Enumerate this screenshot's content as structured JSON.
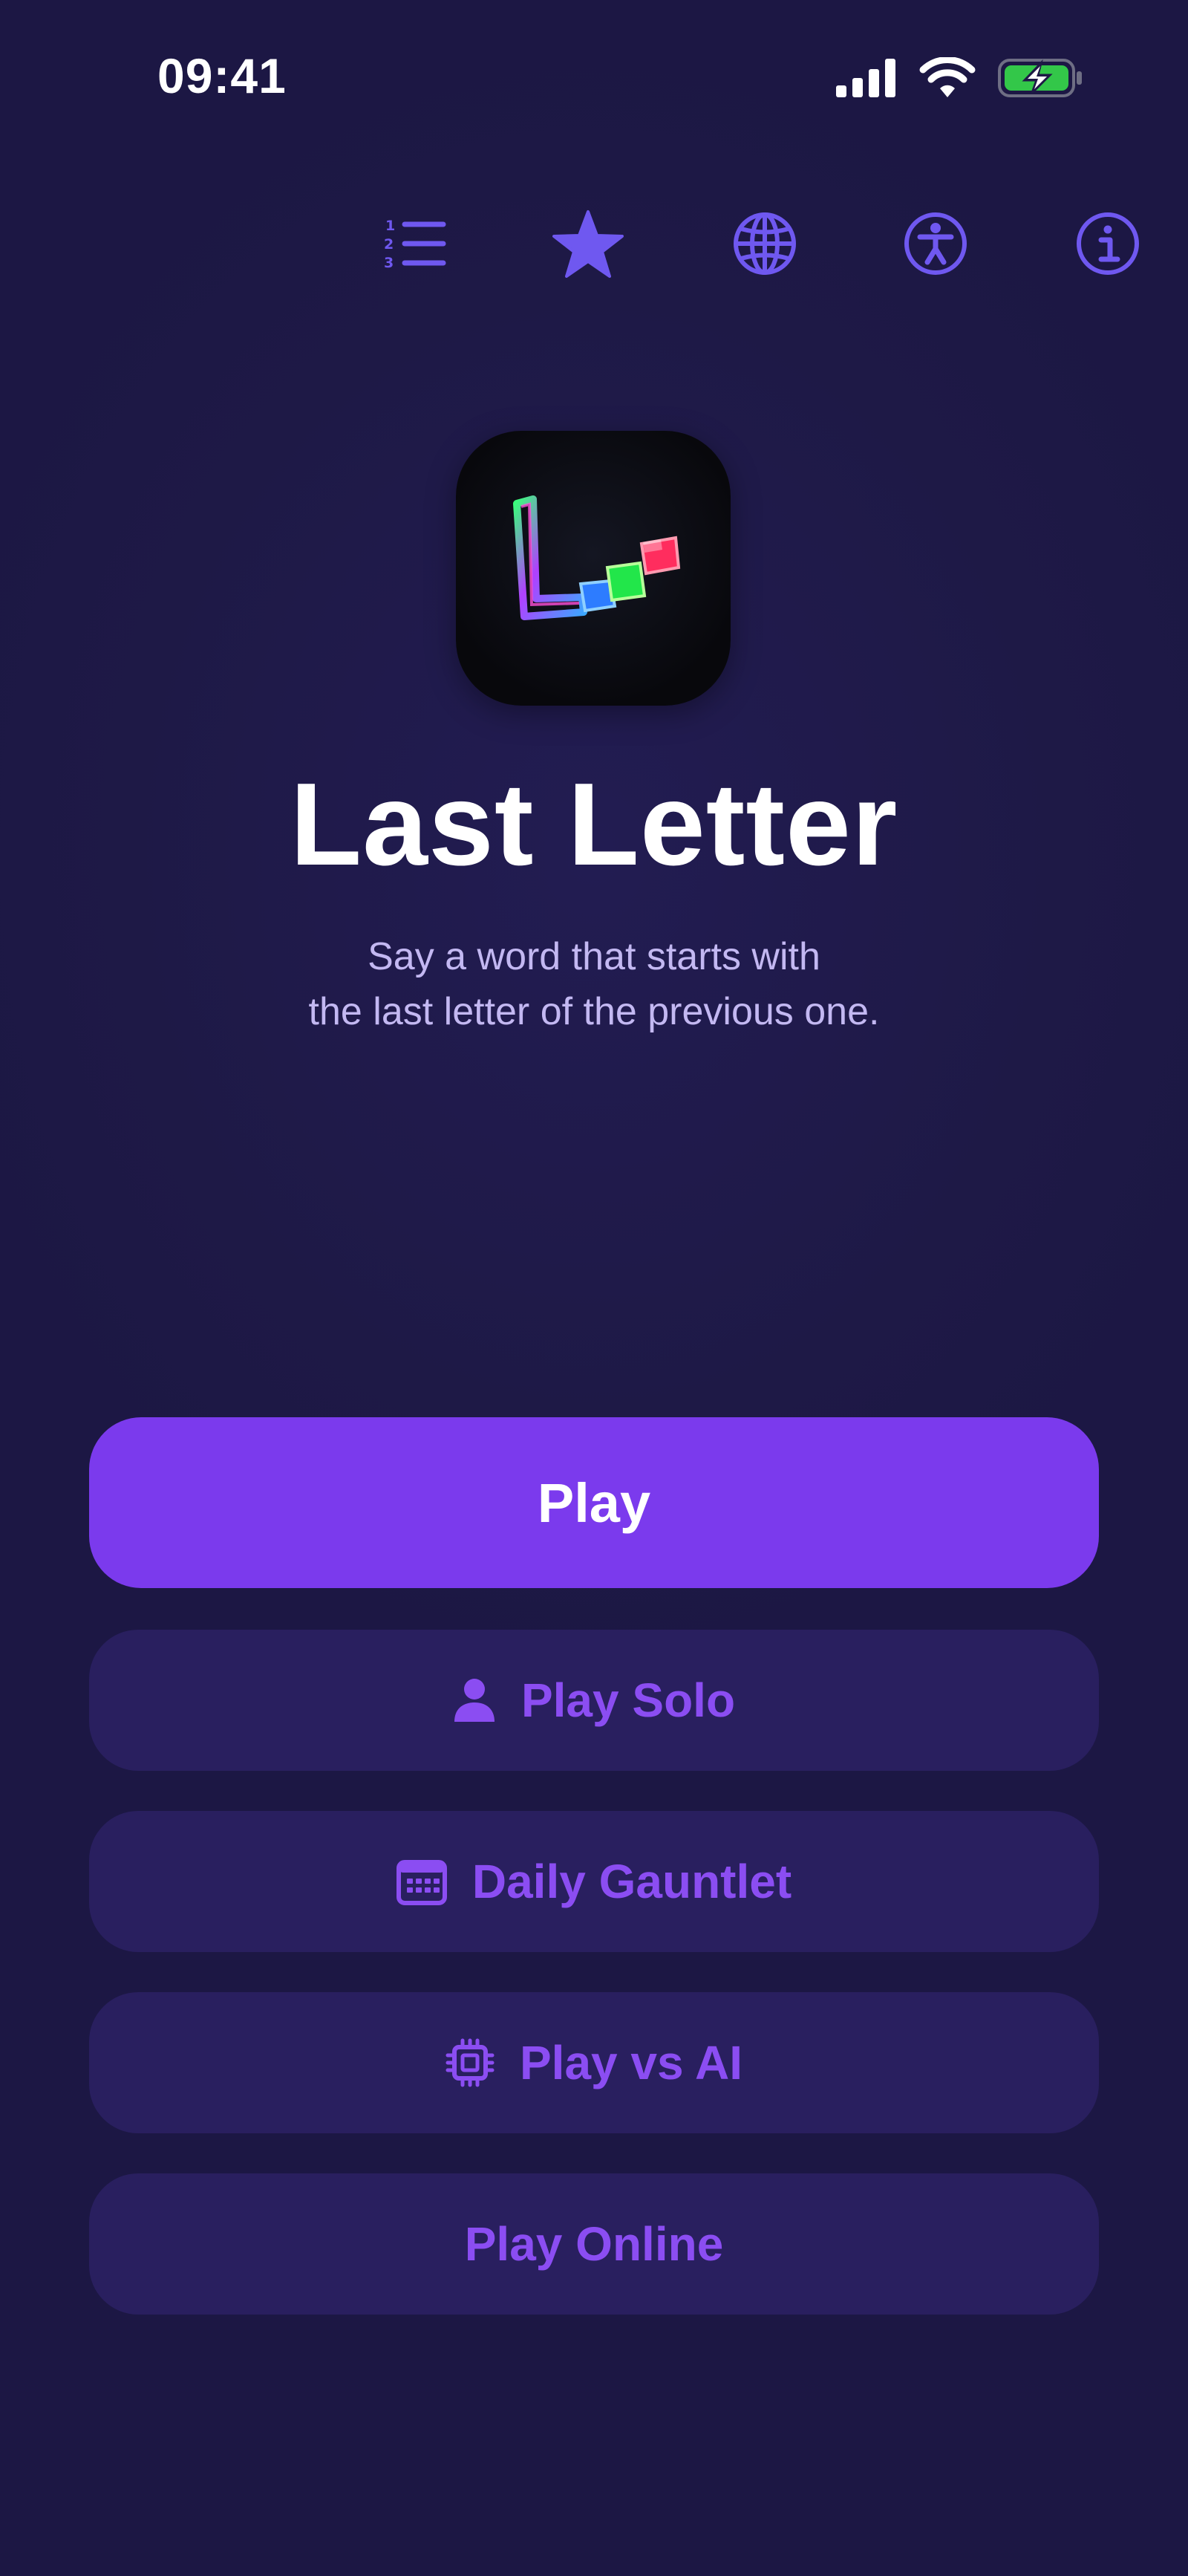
{
  "status_bar": {
    "time": "09:41",
    "icons": [
      "cellular-signal-icon",
      "wifi-icon",
      "battery-charging-icon"
    ]
  },
  "toolbar": {
    "items": [
      {
        "name": "leaderboard-icon"
      },
      {
        "name": "star-icon"
      },
      {
        "name": "globe-icon"
      },
      {
        "name": "accessibility-icon"
      },
      {
        "name": "info-icon"
      }
    ],
    "accent_color": "#6f58f0"
  },
  "hero": {
    "title": "Last Letter",
    "subtitle_line1": "Say a word that starts with",
    "subtitle_line2": "the last letter of the previous one."
  },
  "actions": {
    "play": "Play",
    "play_solo": "Play Solo",
    "daily_gauntlet": "Daily Gauntlet",
    "play_vs_ai": "Play vs AI",
    "play_online": "Play Online"
  },
  "colors": {
    "background": "#1e1946",
    "primary_button": "#7b3aed",
    "secondary_button": "#291f5f",
    "secondary_text": "#8b4df2",
    "subtitle_text": "#c3b8f2"
  }
}
